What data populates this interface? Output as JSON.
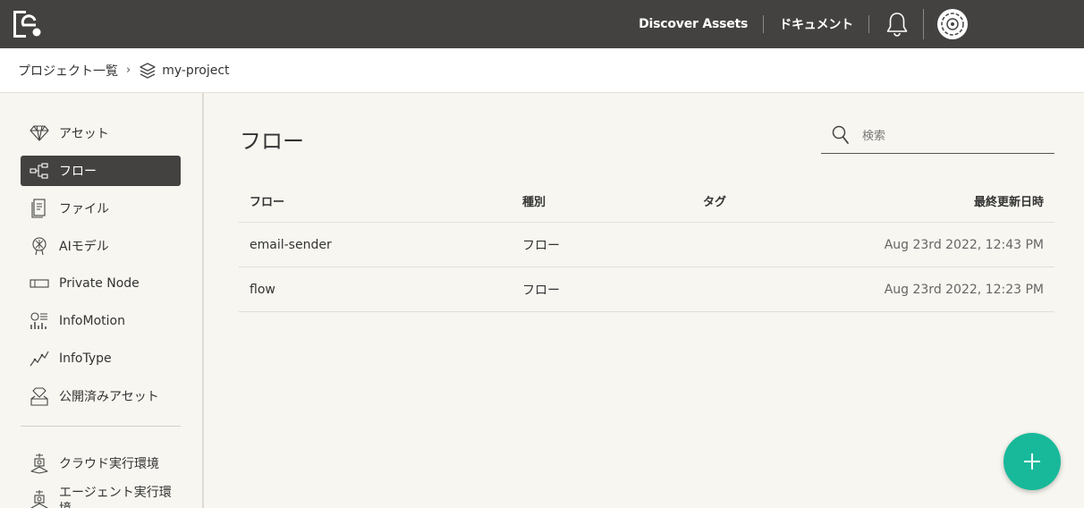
{
  "topbar": {
    "discover_label": "Discover Assets",
    "docs_label": "ドキュメント"
  },
  "breadcrumb": {
    "root": "プロジェクト一覧",
    "separator": "›",
    "project": "my-project"
  },
  "sidebar": {
    "items": [
      {
        "label": "アセット",
        "icon": "diamond-icon"
      },
      {
        "label": "フロー",
        "icon": "flow-icon",
        "active": true
      },
      {
        "label": "ファイル",
        "icon": "file-icon"
      },
      {
        "label": "AIモデル",
        "icon": "ai-model-icon"
      },
      {
        "label": "Private Node",
        "icon": "node-icon"
      },
      {
        "label": "InfoMotion",
        "icon": "infomotion-icon"
      },
      {
        "label": "InfoType",
        "icon": "infotype-icon"
      },
      {
        "label": "公開済みアセット",
        "icon": "published-asset-icon"
      },
      {
        "label": "クラウド実行環境",
        "icon": "cloud-runtime-icon"
      },
      {
        "label": "エージェント実行環境",
        "icon": "agent-runtime-icon"
      }
    ]
  },
  "main": {
    "title": "フロー",
    "search_placeholder": "検索",
    "columns": [
      "フロー",
      "種別",
      "タグ",
      "最終更新日時"
    ],
    "rows": [
      {
        "name": "email-sender",
        "type": "フロー",
        "tag": "",
        "updated": "Aug 23rd 2022, 12:43 PM"
      },
      {
        "name": "flow",
        "type": "フロー",
        "tag": "",
        "updated": "Aug 23rd 2022, 12:23 PM"
      }
    ]
  },
  "colors": {
    "topbar": "#434240",
    "accent": "#18b99a",
    "background": "#f7f6f0"
  }
}
